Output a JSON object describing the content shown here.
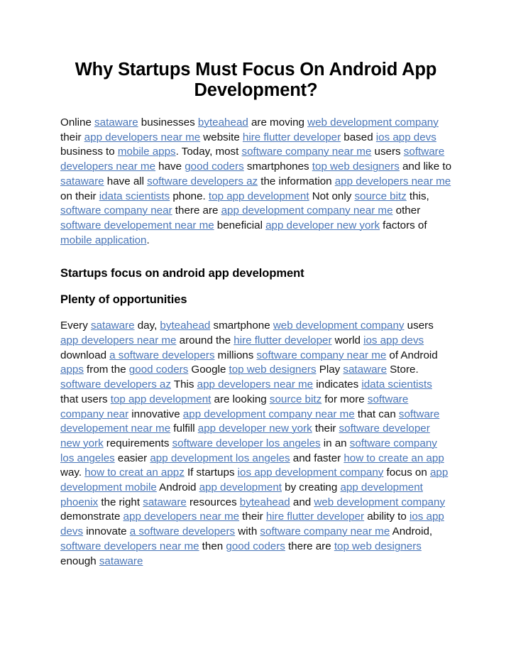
{
  "document": {
    "title": "Why Startups Must Focus On Android App Development?",
    "link_color": "#4a76b8",
    "text_color": "#111111",
    "background_color": "#ffffff",
    "headings": [
      "Startups focus on android app development",
      "Plenty of opportunities"
    ],
    "paragraphs": [
      {
        "id": "paragraph-1",
        "runs": [
          {
            "t": "Online ",
            "link": false
          },
          {
            "t": "sataware",
            "link": true
          },
          {
            "t": " businesses ",
            "link": false
          },
          {
            "t": "byteahead",
            "link": true
          },
          {
            "t": " are moving ",
            "link": false
          },
          {
            "t": "web development company",
            "link": true
          },
          {
            "t": " their ",
            "link": false
          },
          {
            "t": "app developers near me",
            "link": true
          },
          {
            "t": " website ",
            "link": false
          },
          {
            "t": "hire flutter developer",
            "link": true
          },
          {
            "t": " based ",
            "link": false
          },
          {
            "t": "ios app devs",
            "link": true
          },
          {
            "t": " business to ",
            "link": false
          },
          {
            "t": "mobile apps",
            "link": true
          },
          {
            "t": ". Today, most ",
            "link": false
          },
          {
            "t": "software company near me",
            "link": true
          },
          {
            "t": " users ",
            "link": false
          },
          {
            "t": "software developers near me",
            "link": true
          },
          {
            "t": " have ",
            "link": false
          },
          {
            "t": "good coders",
            "link": true
          },
          {
            "t": " smartphones ",
            "link": false
          },
          {
            "t": "top web designers",
            "link": true
          },
          {
            "t": " and like to ",
            "link": false
          },
          {
            "t": "sataware",
            "link": true
          },
          {
            "t": " have all ",
            "link": false
          },
          {
            "t": "software developers az",
            "link": true
          },
          {
            "t": " the information ",
            "link": false
          },
          {
            "t": "app developers near me",
            "link": true
          },
          {
            "t": " on their ",
            "link": false
          },
          {
            "t": "idata scientists",
            "link": true
          },
          {
            "t": " phone. ",
            "link": false
          },
          {
            "t": "top app development",
            "link": true
          },
          {
            "t": " Not only ",
            "link": false
          },
          {
            "t": "source bitz",
            "link": true
          },
          {
            "t": " this, ",
            "link": false
          },
          {
            "t": "software company near",
            "link": true
          },
          {
            "t": " there are ",
            "link": false
          },
          {
            "t": "app development company near me",
            "link": true
          },
          {
            "t": " other ",
            "link": false
          },
          {
            "t": "software developement near me",
            "link": true
          },
          {
            "t": " beneficial ",
            "link": false
          },
          {
            "t": "app developer new york",
            "link": true
          },
          {
            "t": " factors of ",
            "link": false
          },
          {
            "t": "mobile application",
            "link": true
          },
          {
            "t": ".",
            "link": false
          }
        ]
      },
      {
        "id": "paragraph-2",
        "runs": [
          {
            "t": "Every ",
            "link": false
          },
          {
            "t": "sataware",
            "link": true
          },
          {
            "t": " day, ",
            "link": false
          },
          {
            "t": "byteahead",
            "link": true
          },
          {
            "t": " smartphone ",
            "link": false
          },
          {
            "t": "web development company",
            "link": true
          },
          {
            "t": " users ",
            "link": false
          },
          {
            "t": "app developers near me",
            "link": true
          },
          {
            "t": " around the ",
            "link": false
          },
          {
            "t": "hire flutter developer",
            "link": true
          },
          {
            "t": " world ",
            "link": false
          },
          {
            "t": "ios app devs",
            "link": true
          },
          {
            "t": " download ",
            "link": false
          },
          {
            "t": "a software developers",
            "link": true
          },
          {
            "t": " millions ",
            "link": false
          },
          {
            "t": "software company near me",
            "link": true
          },
          {
            "t": " of Android ",
            "link": false
          },
          {
            "t": "apps",
            "link": true
          },
          {
            "t": " from the ",
            "link": false
          },
          {
            "t": "good coders",
            "link": true
          },
          {
            "t": " Google ",
            "link": false
          },
          {
            "t": "top web designers",
            "link": true
          },
          {
            "t": " Play ",
            "link": false
          },
          {
            "t": "sataware",
            "link": true
          },
          {
            "t": " Store. ",
            "link": false
          },
          {
            "t": "software developers az",
            "link": true
          },
          {
            "t": " This ",
            "link": false
          },
          {
            "t": "app developers near me",
            "link": true
          },
          {
            "t": " indicates ",
            "link": false
          },
          {
            "t": "idata scientists",
            "link": true
          },
          {
            "t": " that users ",
            "link": false
          },
          {
            "t": "top app development",
            "link": true
          },
          {
            "t": " are looking ",
            "link": false
          },
          {
            "t": "source bitz",
            "link": true
          },
          {
            "t": " for more ",
            "link": false
          },
          {
            "t": "software company near",
            "link": true
          },
          {
            "t": " innovative ",
            "link": false
          },
          {
            "t": "app development company near me",
            "link": true
          },
          {
            "t": " that can ",
            "link": false
          },
          {
            "t": "software developement near me",
            "link": true
          },
          {
            "t": " fulfill ",
            "link": false
          },
          {
            "t": "app developer new york",
            "link": true
          },
          {
            "t": " their ",
            "link": false
          },
          {
            "t": "software developer new york",
            "link": true
          },
          {
            "t": " requirements ",
            "link": false
          },
          {
            "t": "software developer los angeles",
            "link": true
          },
          {
            "t": " in an ",
            "link": false
          },
          {
            "t": "software company los angeles",
            "link": true
          },
          {
            "t": " easier ",
            "link": false
          },
          {
            "t": "app development los angeles",
            "link": true
          },
          {
            "t": " and faster ",
            "link": false
          },
          {
            "t": "how to create an app",
            "link": true
          },
          {
            "t": " way. ",
            "link": false
          },
          {
            "t": "how to creat an appz",
            "link": true
          },
          {
            "t": " If startups ",
            "link": false
          },
          {
            "t": "ios app development company",
            "link": true
          },
          {
            "t": " focus on ",
            "link": false
          },
          {
            "t": "app development mobile",
            "link": true
          },
          {
            "t": " Android ",
            "link": false
          },
          {
            "t": "app development",
            "link": true
          },
          {
            "t": " by creating ",
            "link": false
          },
          {
            "t": "app development phoenix",
            "link": true
          },
          {
            "t": " the right ",
            "link": false
          },
          {
            "t": "sataware",
            "link": true
          },
          {
            "t": " resources ",
            "link": false
          },
          {
            "t": "byteahead",
            "link": true
          },
          {
            "t": " and ",
            "link": false
          },
          {
            "t": "web development company",
            "link": true
          },
          {
            "t": " demonstrate ",
            "link": false
          },
          {
            "t": "app developers near me",
            "link": true
          },
          {
            "t": " their ",
            "link": false
          },
          {
            "t": "hire flutter developer",
            "link": true
          },
          {
            "t": " ability to ",
            "link": false
          },
          {
            "t": "ios app devs",
            "link": true
          },
          {
            "t": " innovate ",
            "link": false
          },
          {
            "t": "a software developers",
            "link": true
          },
          {
            "t": " with ",
            "link": false
          },
          {
            "t": "software company near me",
            "link": true
          },
          {
            "t": " Android, ",
            "link": false
          },
          {
            "t": "software developers near me",
            "link": true
          },
          {
            "t": " then ",
            "link": false
          },
          {
            "t": "good coders",
            "link": true
          },
          {
            "t": " there are ",
            "link": false
          },
          {
            "t": "top web designers",
            "link": true
          },
          {
            "t": " enough ",
            "link": false
          },
          {
            "t": "sataware",
            "link": true
          }
        ]
      }
    ]
  }
}
